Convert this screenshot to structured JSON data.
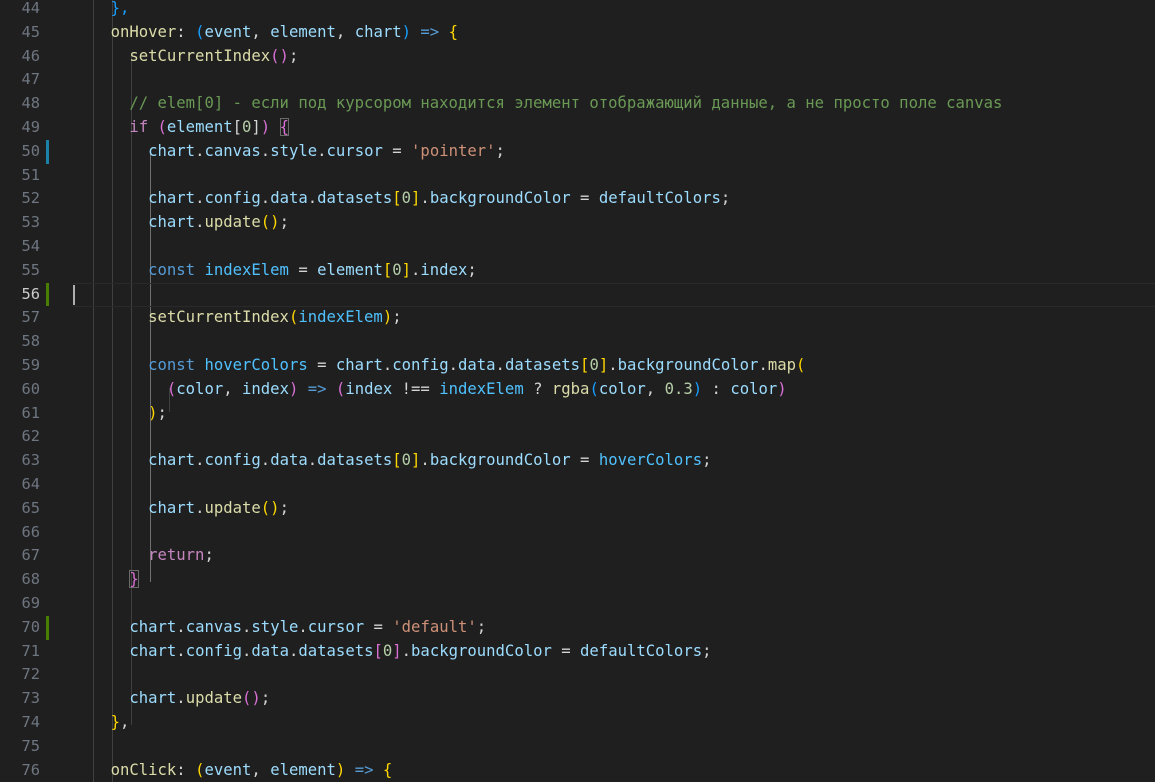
{
  "editor": {
    "language": "javascript",
    "active_line": "56",
    "lines": [
      {
        "n": "44",
        "gutter": "",
        "tokens": [
          {
            "t": "    ",
            "c": "p"
          },
          {
            "t": "},",
            "c": "b3"
          }
        ]
      },
      {
        "n": "45",
        "gutter": "",
        "tokens": [
          {
            "t": "    ",
            "c": "p"
          },
          {
            "t": "onHover",
            "c": "fn"
          },
          {
            "t": ": ",
            "c": "p"
          },
          {
            "t": "(",
            "c": "b3"
          },
          {
            "t": "event",
            "c": "vr"
          },
          {
            "t": ", ",
            "c": "p"
          },
          {
            "t": "element",
            "c": "vr"
          },
          {
            "t": ", ",
            "c": "p"
          },
          {
            "t": "chart",
            "c": "vr"
          },
          {
            "t": ")",
            "c": "b3"
          },
          {
            "t": " ",
            "c": "p"
          },
          {
            "t": "=>",
            "c": "st"
          },
          {
            "t": " ",
            "c": "p"
          },
          {
            "t": "{",
            "c": "b1"
          }
        ]
      },
      {
        "n": "46",
        "gutter": "",
        "tokens": [
          {
            "t": "      ",
            "c": "p"
          },
          {
            "t": "setCurrentIndex",
            "c": "fn"
          },
          {
            "t": "()",
            "c": "b2"
          },
          {
            "t": ";",
            "c": "p"
          }
        ]
      },
      {
        "n": "47",
        "gutter": "",
        "tokens": []
      },
      {
        "n": "48",
        "gutter": "",
        "tokens": [
          {
            "t": "      ",
            "c": "p"
          },
          {
            "t": "// elem[0] - если под курсором находится элемент отображающий данные, а не просто поле canvas",
            "c": "cm"
          }
        ]
      },
      {
        "n": "49",
        "gutter": "",
        "tokens": [
          {
            "t": "      ",
            "c": "p"
          },
          {
            "t": "if",
            "c": "kw"
          },
          {
            "t": " ",
            "c": "p"
          },
          {
            "t": "(",
            "c": "b2"
          },
          {
            "t": "element",
            "c": "vr"
          },
          {
            "t": "[",
            "c": "p"
          },
          {
            "t": "0",
            "c": "nm"
          },
          {
            "t": "]",
            "c": "p"
          },
          {
            "t": ")",
            "c": "b2"
          },
          {
            "t": " ",
            "c": "p"
          },
          {
            "t": "{",
            "c": "b2",
            "m": true
          }
        ]
      },
      {
        "n": "50",
        "gutter": "mod",
        "tokens": [
          {
            "t": "        ",
            "c": "p"
          },
          {
            "t": "chart",
            "c": "vr"
          },
          {
            "t": ".",
            "c": "p"
          },
          {
            "t": "canvas",
            "c": "vr"
          },
          {
            "t": ".",
            "c": "p"
          },
          {
            "t": "style",
            "c": "vr"
          },
          {
            "t": ".",
            "c": "p"
          },
          {
            "t": "cursor",
            "c": "vr"
          },
          {
            "t": " = ",
            "c": "p"
          },
          {
            "t": "'pointer'",
            "c": "sg"
          },
          {
            "t": ";",
            "c": "p"
          }
        ]
      },
      {
        "n": "51",
        "gutter": "",
        "tokens": []
      },
      {
        "n": "52",
        "gutter": "",
        "tokens": [
          {
            "t": "        ",
            "c": "p"
          },
          {
            "t": "chart",
            "c": "vr"
          },
          {
            "t": ".",
            "c": "p"
          },
          {
            "t": "config",
            "c": "vr"
          },
          {
            "t": ".",
            "c": "p"
          },
          {
            "t": "data",
            "c": "vr"
          },
          {
            "t": ".",
            "c": "p"
          },
          {
            "t": "datasets",
            "c": "vr"
          },
          {
            "t": "[",
            "c": "b1"
          },
          {
            "t": "0",
            "c": "nm"
          },
          {
            "t": "]",
            "c": "b1"
          },
          {
            "t": ".",
            "c": "p"
          },
          {
            "t": "backgroundColor",
            "c": "vr"
          },
          {
            "t": " = ",
            "c": "p"
          },
          {
            "t": "defaultColors",
            "c": "vr"
          },
          {
            "t": ";",
            "c": "p"
          }
        ]
      },
      {
        "n": "53",
        "gutter": "",
        "tokens": [
          {
            "t": "        ",
            "c": "p"
          },
          {
            "t": "chart",
            "c": "vr"
          },
          {
            "t": ".",
            "c": "p"
          },
          {
            "t": "update",
            "c": "fn"
          },
          {
            "t": "()",
            "c": "b1"
          },
          {
            "t": ";",
            "c": "p"
          }
        ]
      },
      {
        "n": "54",
        "gutter": "",
        "tokens": []
      },
      {
        "n": "55",
        "gutter": "",
        "tokens": [
          {
            "t": "        ",
            "c": "p"
          },
          {
            "t": "const",
            "c": "st"
          },
          {
            "t": " ",
            "c": "p"
          },
          {
            "t": "indexElem",
            "c": "cn"
          },
          {
            "t": " = ",
            "c": "p"
          },
          {
            "t": "element",
            "c": "vr"
          },
          {
            "t": "[",
            "c": "b1"
          },
          {
            "t": "0",
            "c": "nm"
          },
          {
            "t": "]",
            "c": "b1"
          },
          {
            "t": ".",
            "c": "p"
          },
          {
            "t": "index",
            "c": "vr"
          },
          {
            "t": ";",
            "c": "p"
          }
        ]
      },
      {
        "n": "56",
        "gutter": "add",
        "tokens": []
      },
      {
        "n": "57",
        "gutter": "",
        "tokens": [
          {
            "t": "        ",
            "c": "p"
          },
          {
            "t": "setCurrentIndex",
            "c": "fn"
          },
          {
            "t": "(",
            "c": "b1"
          },
          {
            "t": "indexElem",
            "c": "cn"
          },
          {
            "t": ")",
            "c": "b1"
          },
          {
            "t": ";",
            "c": "p"
          }
        ]
      },
      {
        "n": "58",
        "gutter": "",
        "tokens": []
      },
      {
        "n": "59",
        "gutter": "",
        "tokens": [
          {
            "t": "        ",
            "c": "p"
          },
          {
            "t": "const",
            "c": "st"
          },
          {
            "t": " ",
            "c": "p"
          },
          {
            "t": "hoverColors",
            "c": "cn"
          },
          {
            "t": " = ",
            "c": "p"
          },
          {
            "t": "chart",
            "c": "vr"
          },
          {
            "t": ".",
            "c": "p"
          },
          {
            "t": "config",
            "c": "vr"
          },
          {
            "t": ".",
            "c": "p"
          },
          {
            "t": "data",
            "c": "vr"
          },
          {
            "t": ".",
            "c": "p"
          },
          {
            "t": "datasets",
            "c": "vr"
          },
          {
            "t": "[",
            "c": "b1"
          },
          {
            "t": "0",
            "c": "nm"
          },
          {
            "t": "]",
            "c": "b1"
          },
          {
            "t": ".",
            "c": "p"
          },
          {
            "t": "backgroundColor",
            "c": "vr"
          },
          {
            "t": ".",
            "c": "p"
          },
          {
            "t": "map",
            "c": "fn"
          },
          {
            "t": "(",
            "c": "b1"
          }
        ]
      },
      {
        "n": "60",
        "gutter": "",
        "tokens": [
          {
            "t": "          ",
            "c": "p"
          },
          {
            "t": "(",
            "c": "b2"
          },
          {
            "t": "color",
            "c": "vr"
          },
          {
            "t": ", ",
            "c": "p"
          },
          {
            "t": "index",
            "c": "vr"
          },
          {
            "t": ")",
            "c": "b2"
          },
          {
            "t": " ",
            "c": "p"
          },
          {
            "t": "=>",
            "c": "st"
          },
          {
            "t": " ",
            "c": "p"
          },
          {
            "t": "(",
            "c": "b2"
          },
          {
            "t": "index",
            "c": "vr"
          },
          {
            "t": " !== ",
            "c": "p"
          },
          {
            "t": "indexElem",
            "c": "cn"
          },
          {
            "t": " ? ",
            "c": "p"
          },
          {
            "t": "rgba",
            "c": "fn"
          },
          {
            "t": "(",
            "c": "b3"
          },
          {
            "t": "color",
            "c": "vr"
          },
          {
            "t": ", ",
            "c": "p"
          },
          {
            "t": "0.3",
            "c": "nm"
          },
          {
            "t": ")",
            "c": "b3"
          },
          {
            "t": " : ",
            "c": "p"
          },
          {
            "t": "color",
            "c": "vr"
          },
          {
            "t": ")",
            "c": "b2"
          }
        ]
      },
      {
        "n": "61",
        "gutter": "",
        "tokens": [
          {
            "t": "        ",
            "c": "p"
          },
          {
            "t": ")",
            "c": "b1"
          },
          {
            "t": ";",
            "c": "p"
          }
        ]
      },
      {
        "n": "62",
        "gutter": "",
        "tokens": []
      },
      {
        "n": "63",
        "gutter": "",
        "tokens": [
          {
            "t": "        ",
            "c": "p"
          },
          {
            "t": "chart",
            "c": "vr"
          },
          {
            "t": ".",
            "c": "p"
          },
          {
            "t": "config",
            "c": "vr"
          },
          {
            "t": ".",
            "c": "p"
          },
          {
            "t": "data",
            "c": "vr"
          },
          {
            "t": ".",
            "c": "p"
          },
          {
            "t": "datasets",
            "c": "vr"
          },
          {
            "t": "[",
            "c": "b1"
          },
          {
            "t": "0",
            "c": "nm"
          },
          {
            "t": "]",
            "c": "b1"
          },
          {
            "t": ".",
            "c": "p"
          },
          {
            "t": "backgroundColor",
            "c": "vr"
          },
          {
            "t": " = ",
            "c": "p"
          },
          {
            "t": "hoverColors",
            "c": "cn"
          },
          {
            "t": ";",
            "c": "p"
          }
        ]
      },
      {
        "n": "64",
        "gutter": "",
        "tokens": []
      },
      {
        "n": "65",
        "gutter": "",
        "tokens": [
          {
            "t": "        ",
            "c": "p"
          },
          {
            "t": "chart",
            "c": "vr"
          },
          {
            "t": ".",
            "c": "p"
          },
          {
            "t": "update",
            "c": "fn"
          },
          {
            "t": "()",
            "c": "b1"
          },
          {
            "t": ";",
            "c": "p"
          }
        ]
      },
      {
        "n": "66",
        "gutter": "",
        "tokens": []
      },
      {
        "n": "67",
        "gutter": "",
        "tokens": [
          {
            "t": "        ",
            "c": "p"
          },
          {
            "t": "return",
            "c": "kw"
          },
          {
            "t": ";",
            "c": "p"
          }
        ]
      },
      {
        "n": "68",
        "gutter": "",
        "tokens": [
          {
            "t": "      ",
            "c": "p"
          },
          {
            "t": "}",
            "c": "b2",
            "m": true
          }
        ]
      },
      {
        "n": "69",
        "gutter": "",
        "tokens": []
      },
      {
        "n": "70",
        "gutter": "add",
        "tokens": [
          {
            "t": "      ",
            "c": "p"
          },
          {
            "t": "chart",
            "c": "vr"
          },
          {
            "t": ".",
            "c": "p"
          },
          {
            "t": "canvas",
            "c": "vr"
          },
          {
            "t": ".",
            "c": "p"
          },
          {
            "t": "style",
            "c": "vr"
          },
          {
            "t": ".",
            "c": "p"
          },
          {
            "t": "cursor",
            "c": "vr"
          },
          {
            "t": " = ",
            "c": "p"
          },
          {
            "t": "'default'",
            "c": "sg"
          },
          {
            "t": ";",
            "c": "p"
          }
        ]
      },
      {
        "n": "71",
        "gutter": "",
        "tokens": [
          {
            "t": "      ",
            "c": "p"
          },
          {
            "t": "chart",
            "c": "vr"
          },
          {
            "t": ".",
            "c": "p"
          },
          {
            "t": "config",
            "c": "vr"
          },
          {
            "t": ".",
            "c": "p"
          },
          {
            "t": "data",
            "c": "vr"
          },
          {
            "t": ".",
            "c": "p"
          },
          {
            "t": "datasets",
            "c": "vr"
          },
          {
            "t": "[",
            "c": "b2"
          },
          {
            "t": "0",
            "c": "nm"
          },
          {
            "t": "]",
            "c": "b2"
          },
          {
            "t": ".",
            "c": "p"
          },
          {
            "t": "backgroundColor",
            "c": "vr"
          },
          {
            "t": " = ",
            "c": "p"
          },
          {
            "t": "defaultColors",
            "c": "vr"
          },
          {
            "t": ";",
            "c": "p"
          }
        ]
      },
      {
        "n": "72",
        "gutter": "",
        "tokens": []
      },
      {
        "n": "73",
        "gutter": "",
        "tokens": [
          {
            "t": "      ",
            "c": "p"
          },
          {
            "t": "chart",
            "c": "vr"
          },
          {
            "t": ".",
            "c": "p"
          },
          {
            "t": "update",
            "c": "fn"
          },
          {
            "t": "()",
            "c": "b2"
          },
          {
            "t": ";",
            "c": "p"
          }
        ]
      },
      {
        "n": "74",
        "gutter": "",
        "tokens": [
          {
            "t": "    ",
            "c": "p"
          },
          {
            "t": "}",
            "c": "b1"
          },
          {
            "t": ",",
            "c": "p"
          }
        ]
      },
      {
        "n": "75",
        "gutter": "",
        "tokens": []
      },
      {
        "n": "76",
        "gutter": "",
        "tokens": [
          {
            "t": "    ",
            "c": "p"
          },
          {
            "t": "onClick",
            "c": "fn"
          },
          {
            "t": ": ",
            "c": "p"
          },
          {
            "t": "(",
            "c": "b1"
          },
          {
            "t": "event",
            "c": "vr"
          },
          {
            "t": ", ",
            "c": "p"
          },
          {
            "t": "element",
            "c": "vr"
          },
          {
            "t": ")",
            "c": "b1"
          },
          {
            "t": " ",
            "c": "p"
          },
          {
            "t": "=>",
            "c": "st"
          },
          {
            "t": " ",
            "c": "p"
          },
          {
            "t": "{",
            "c": "b1"
          }
        ]
      }
    ]
  }
}
